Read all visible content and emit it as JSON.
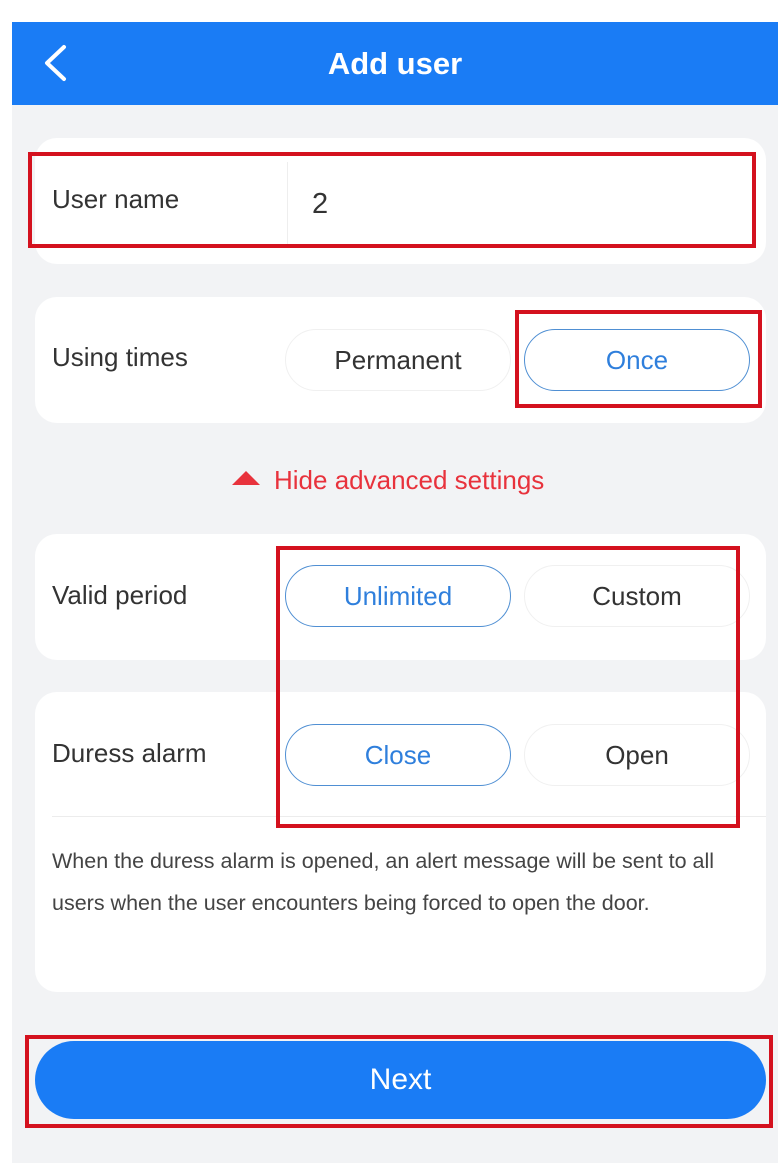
{
  "header": {
    "back_icon": "chevron-left-icon",
    "title": "Add user"
  },
  "user_name": {
    "label": "User name",
    "value": "2"
  },
  "using_times": {
    "label": "Using times",
    "options": [
      "Permanent",
      "Once"
    ],
    "selected": "Once"
  },
  "advanced_toggle": {
    "icon": "triangle-up-icon",
    "label": "Hide advanced settings"
  },
  "valid_period": {
    "label": "Valid period",
    "options": [
      "Unlimited",
      "Custom"
    ],
    "selected": "Unlimited"
  },
  "duress_alarm": {
    "label": "Duress alarm",
    "options": [
      "Close",
      "Open"
    ],
    "selected": "Close",
    "description": "When the duress alarm is opened, an alert message will be sent to all users when the user encounters being forced to open the door."
  },
  "next_button": {
    "label": "Next"
  },
  "colors": {
    "primary": "#1a7cf5",
    "selected_text": "#2f7fdc",
    "warning": "#e8323c",
    "highlight_box": "#d4111e",
    "background": "#f2f3f5"
  }
}
